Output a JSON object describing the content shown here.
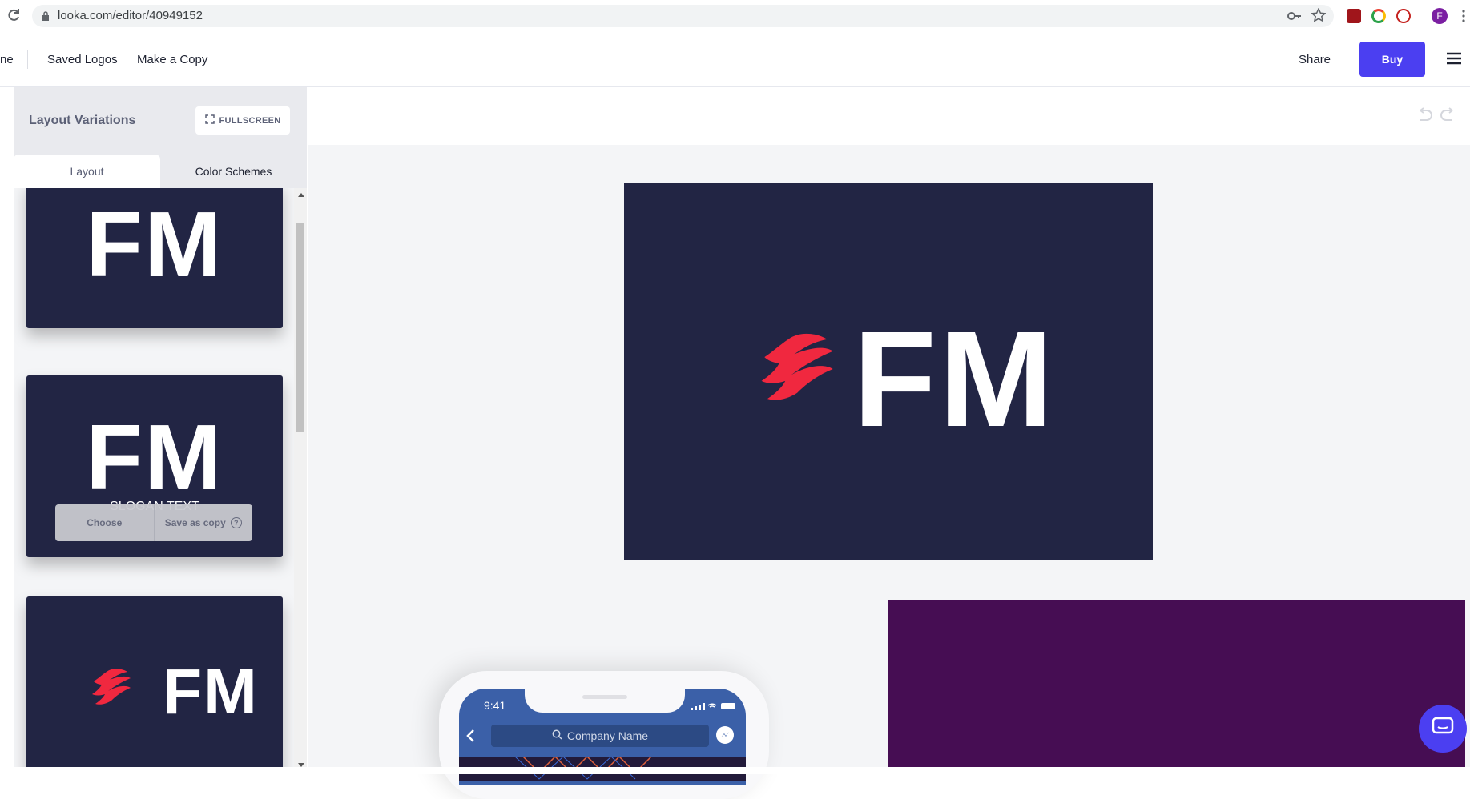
{
  "browser": {
    "url": "looka.com/editor/40949152",
    "avatar_letter": "F"
  },
  "header": {
    "partial_left": "ne",
    "nav": [
      "Saved Logos",
      "Make a Copy"
    ],
    "share_label": "Share",
    "buy_label": "Buy",
    "accent": "#4b3ff1"
  },
  "sidebar": {
    "title": "Layout Variations",
    "fullscreen_label": "FULLSCREEN",
    "tabs": [
      "Layout",
      "Color Schemes"
    ],
    "cards": [
      {
        "logo": "FM"
      },
      {
        "logo": "FM",
        "slogan": "SLOGAN TEXT",
        "choose_label": "Choose",
        "save_copy_label": "Save as copy"
      },
      {
        "logo": "FM"
      }
    ]
  },
  "canvas": {
    "logo_text": "FM",
    "logo_bg": "#222544",
    "mark_color": "#f0283f",
    "phone": {
      "time": "9:41",
      "search_placeholder": "Company Name"
    }
  }
}
